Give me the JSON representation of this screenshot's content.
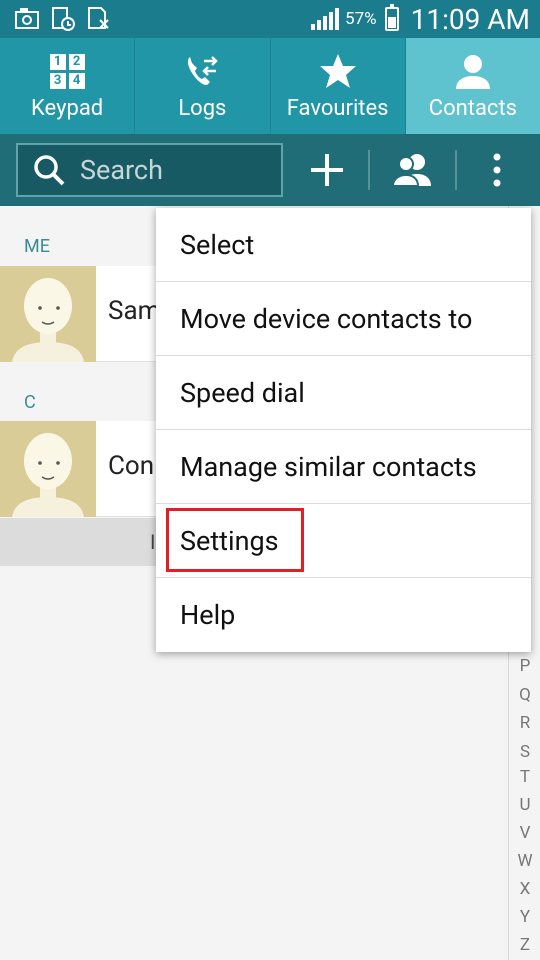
{
  "status": {
    "time": "11:09 AM",
    "battery": "57%",
    "left_icons": [
      "gallery-icon",
      "missed-call-icon",
      "no-sim-icon"
    ]
  },
  "tabs": [
    {
      "label": "Keypad",
      "icon": "keypad-icon",
      "keypad_digits": [
        "1",
        "2",
        "3",
        "4"
      ]
    },
    {
      "label": "Logs",
      "icon": "logs-icon"
    },
    {
      "label": "Favourites",
      "icon": "star-icon"
    },
    {
      "label": "Contacts",
      "icon": "person-icon",
      "active": true
    }
  ],
  "toolbar": {
    "search_placeholder": "Search"
  },
  "list": {
    "sections": [
      {
        "header": "ME",
        "contact": "Sam"
      },
      {
        "header": "C",
        "contact": "Con"
      }
    ],
    "more_label": "I"
  },
  "menu": {
    "items": [
      "Select",
      "Move device contacts to",
      "Speed dial",
      "Manage similar contacts",
      "Settings",
      "Help"
    ],
    "highlighted": "Settings"
  },
  "index_letters": [
    "P",
    "Q",
    "R",
    "S",
    "T",
    "U",
    "V",
    "W",
    "X",
    "Y",
    "Z"
  ],
  "colors": {
    "accent": "#2196a6",
    "active_tab": "#5ec2cf",
    "highlight": "#e21f26"
  }
}
